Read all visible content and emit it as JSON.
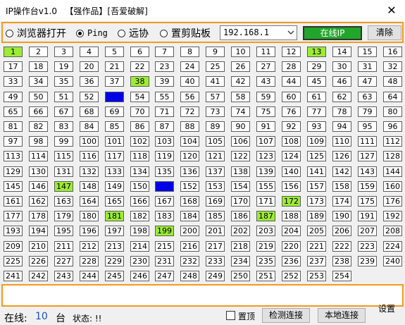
{
  "window": {
    "title": "IP操作台v1.0   【强作品】[吾爱破解]",
    "close_glyph": "✕"
  },
  "toolbar": {
    "modes": [
      {
        "label": "浏览器打开",
        "checked": false
      },
      {
        "label": "Ping",
        "checked": true
      },
      {
        "label": "远协",
        "checked": false
      },
      {
        "label": "置剪贴板",
        "checked": false
      }
    ],
    "ip_prefix": "192.168.1",
    "online_ip_label": "在线IP",
    "clear_label": "清除"
  },
  "grid": {
    "count": 254,
    "columns": 16,
    "highlighted_green": [
      1,
      13,
      38,
      147,
      172,
      181,
      187,
      199
    ],
    "highlighted_blue": [
      53,
      151
    ]
  },
  "status": {
    "online_label": "在线:",
    "online_count": "10",
    "online_unit": "台",
    "state_label": "状态: !!",
    "topmost_label": "置顶",
    "topmost_checked": false,
    "detect_label": "检测连接",
    "local_label": "本地连接",
    "settings_label": "设置"
  },
  "colors": {
    "accent_orange": "#f39a1e",
    "online_green": "#22a52b",
    "cell_green": "#9cec35",
    "cell_blue": "#0000e6"
  }
}
